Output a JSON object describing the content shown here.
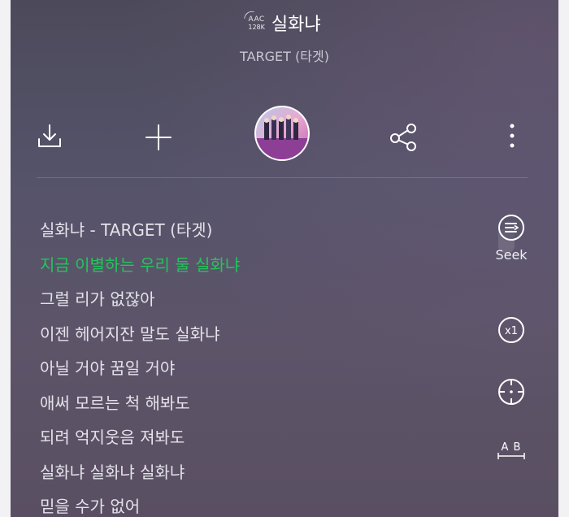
{
  "header": {
    "codec_format": "AAC",
    "codec_bitrate": "128K",
    "title": "실화냐",
    "artist": "TARGET (타겟)"
  },
  "toolbar": {
    "icons": [
      "download-icon",
      "add-icon",
      "album-art",
      "share-icon",
      "more-icon"
    ]
  },
  "lyrics": [
    {
      "text": "실화냐 - TARGET (타겟)",
      "current": false
    },
    {
      "text": "지금 이별하는 우리 둘 실화냐",
      "current": true
    },
    {
      "text": "그럴 리가 없잖아",
      "current": false
    },
    {
      "text": "이젠 헤어지잔 말도 실화냐",
      "current": false
    },
    {
      "text": "아닐 거야 꿈일 거야",
      "current": false
    },
    {
      "text": "애써 모르는 척 해봐도",
      "current": false
    },
    {
      "text": "되려 억지웃음 져봐도",
      "current": false
    },
    {
      "text": "실화냐 실화냐 실화냐",
      "current": false
    },
    {
      "text": "믿을 수가 없어",
      "current": false
    }
  ],
  "side_controls": {
    "seek_label": "Seek",
    "speed_label": "x1",
    "ab_label": "A B"
  },
  "colors": {
    "current_lyric": "#21c65a",
    "lyric": "#e4e2ea",
    "background": "#524f63"
  }
}
